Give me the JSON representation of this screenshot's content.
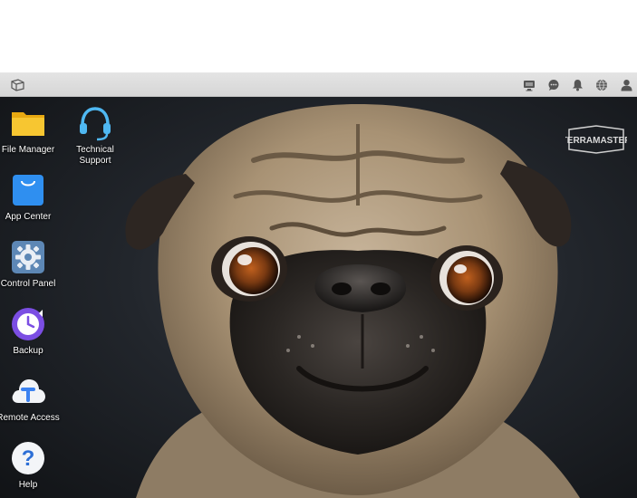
{
  "taskbar": {
    "start_icon": "cube-icon",
    "right_icons": [
      "monitor-icon",
      "chat-icon",
      "bell-icon",
      "globe-icon",
      "user-icon"
    ]
  },
  "desktop": {
    "icons": [
      {
        "label": "File Manager",
        "icon": "folder-icon"
      },
      {
        "label": "Technical Support",
        "label_line1": "Technical",
        "label_line2": "Support",
        "icon": "headset-icon"
      },
      {
        "label": "App Center",
        "icon": "shopping-bag-icon"
      },
      {
        "label": "Control Panel",
        "icon": "gear-icon"
      },
      {
        "label": "Backup",
        "icon": "clock-icon"
      },
      {
        "label": "Remote Access",
        "icon": "cloud-icon"
      },
      {
        "label": "Help",
        "icon": "question-icon"
      }
    ],
    "brand": "TERRAMASTER",
    "wallpaper": "pug-photo"
  },
  "colors": {
    "taskbar_bg": "#dcdcdc",
    "folder": "#f5c518",
    "app_center": "#3d8ef0",
    "control_panel": "#5b86b7",
    "backup": "#7a4fe0",
    "headset": "#39a7e8"
  }
}
